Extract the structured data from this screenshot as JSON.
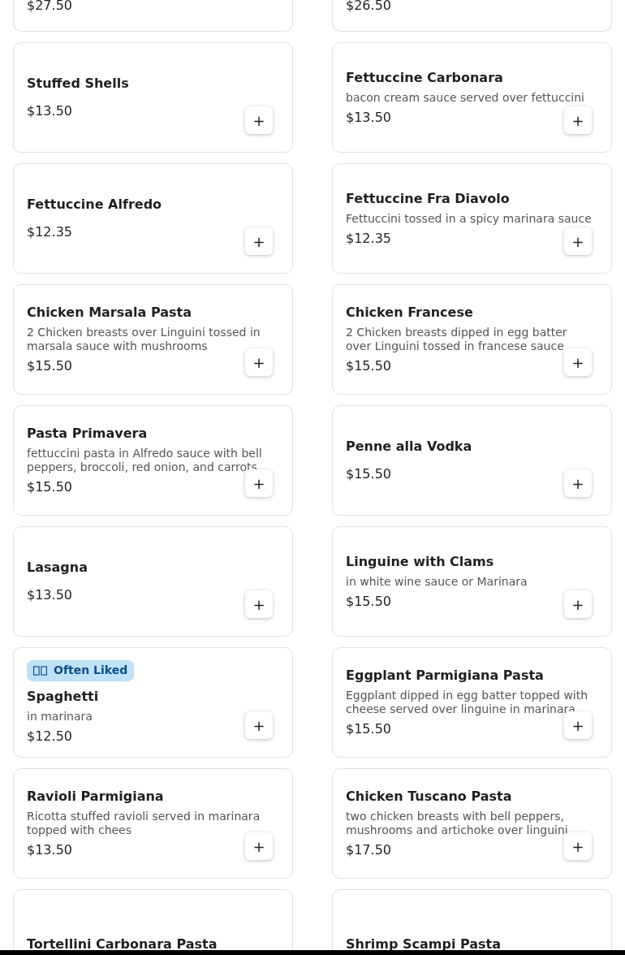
{
  "items": [
    {
      "price": "$27.50"
    },
    {
      "price": "$26.50"
    },
    {
      "name": "Stuffed Shells",
      "price": "$13.50",
      "button": "+"
    },
    {
      "name": "Fettuccine Carbonara",
      "description": "bacon cream sauce served over fettuccini",
      "price": "$13.50",
      "button": "+"
    },
    {
      "name": "Fettuccine Alfredo",
      "price": "$12.35",
      "button": "+"
    },
    {
      "name": "Fettuccine Fra Diavolo",
      "description": "Fettuccini tossed in a spicy marinara sauce",
      "price": "$12.35",
      "button": "+"
    },
    {
      "name": "Chicken Marsala Pasta",
      "description": "2 Chicken breasts over Linguini tossed in marsala sauce with mushrooms",
      "price": "$15.50",
      "button": "+"
    },
    {
      "name": "Chicken Francese",
      "description": "2 Chicken breasts dipped in egg batter over Linguini tossed in francese sauce",
      "price": "$15.50",
      "button": "+"
    },
    {
      "name": "Pasta Primavera",
      "description": "fettuccini pasta in Alfredo sauce with bell peppers, broccoli, red onion, and carrots",
      "price": "$15.50",
      "button": "+"
    },
    {
      "name": "Penne alla Vodka",
      "price": "$15.50",
      "button": "+"
    },
    {
      "name": "Lasagna",
      "price": "$13.50",
      "button": "+"
    },
    {
      "name": "Linguine with Clams",
      "description": "in white wine sauce or Marinara",
      "price": "$15.50",
      "button": "+"
    },
    {
      "badge": {
        "text": "Often Liked"
      },
      "name": "Spaghetti",
      "description": "in marinara",
      "price": "$12.50",
      "button": "+"
    },
    {
      "name": "Eggplant Parmigiana Pasta",
      "description": "Eggplant dipped in egg batter topped with cheese served over linguine in marinara",
      "price": "$15.50",
      "button": "+"
    },
    {
      "name": "Ravioli Parmigiana",
      "description": "Ricotta stuffed ravioli served in marinara topped with chees",
      "price": "$13.50",
      "button": "+"
    },
    {
      "name": "Chicken Tuscano Pasta",
      "description": "two chicken breasts with bell peppers, mushrooms and artichoke over linguini",
      "price": "$17.50",
      "button": "+"
    },
    {
      "name": "Tortellini Carbonara Pasta"
    },
    {
      "name": "Shrimp Scampi Pasta"
    }
  ]
}
